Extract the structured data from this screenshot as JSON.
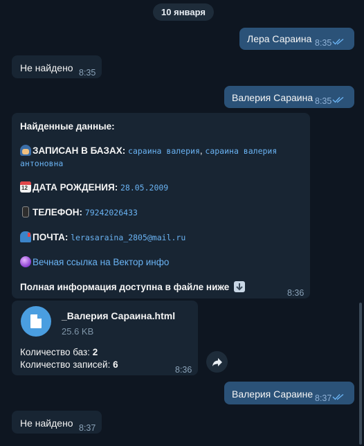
{
  "date_separator": "10 января",
  "messages": [
    {
      "text": "Лера Сараина",
      "time": "8:35"
    },
    {
      "text": "Не найдено",
      "time": "8:35"
    },
    {
      "text": "Валерия Сараина",
      "time": "8:35"
    },
    {
      "text": "Валерия Сараине",
      "time": "8:37"
    },
    {
      "text": "Не найдено",
      "time": "8:37"
    }
  ],
  "rich": {
    "header": "Найденные данные:",
    "bases_label": "ЗАПИСАН В БАЗАХ:",
    "bases_value_1": "сараина валерия",
    "bases_sep": ",",
    "bases_value_2": "сараина валерия",
    "bases_value_3": "антоновна",
    "dob_label": "ДАТА РОЖДЕНИЯ:",
    "dob_value": "28.05.2009",
    "phone_label": "ТЕЛЕФОН:",
    "phone_value": "79242026433",
    "email_label": "ПОЧТА:",
    "email_value": "lerasaraina_2805@mail.ru",
    "link_text": "Вечная ссылка на Вектор инфо",
    "footer": "Полная информация доступна в файле ниже",
    "time": "8:36",
    "emoji_badge": "12"
  },
  "file": {
    "name": "_Валерия Сараина.html",
    "size": "25.6 KB",
    "bases_label": "Количество баз:",
    "bases_count": "2",
    "records_label": "Количество записей:",
    "records_count": "6",
    "time": "8:36"
  },
  "icons": {
    "read_receipt": "double-check-icon",
    "file": "file-icon",
    "forward": "forward-icon",
    "police": "police-officer-emoji",
    "calendar": "calendar-emoji",
    "phone": "mobile-phone-emoji",
    "mail": "mailbox-emoji",
    "crystal": "crystal-ball-emoji",
    "down": "down-arrow-emoji"
  },
  "colors": {
    "background": "#0e1621",
    "bubble_out": "#2b5278",
    "bubble_in": "#182533",
    "link": "#6ab3f3"
  }
}
